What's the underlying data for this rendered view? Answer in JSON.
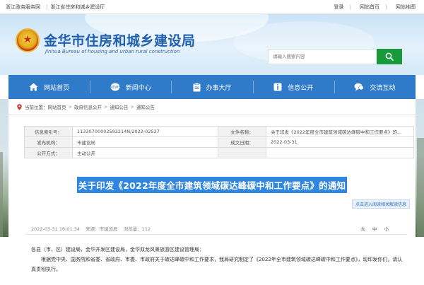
{
  "topbar": {
    "links_left": [
      "浙江政务服务网",
      "浙江省住房和城乡建设厅"
    ],
    "links_right": [
      "登录",
      "网站首页",
      "网站地图"
    ]
  },
  "header": {
    "title": "金华市住房和城乡建设局",
    "subtitle": "Jinhua Bureau of housing and urban rural construction",
    "search_placeholder": "请输入搜索内容"
  },
  "nav": [
    {
      "label": "网站首页",
      "icon": "home-icon"
    },
    {
      "label": "新闻中心",
      "icon": "news-icon"
    },
    {
      "label": "办事大厅",
      "icon": "clipboard-icon"
    },
    {
      "label": "信息公开",
      "icon": "info-icon"
    },
    {
      "label": "交流互动",
      "icon": "chat-icon"
    }
  ],
  "breadcrumb": [
    "当前位置：",
    "网站首页",
    "政府信息公开",
    "通知公告",
    "通知公告"
  ],
  "meta": {
    "index_label": "信息索引号：",
    "index_value": "11330700002592214N/2022-02527",
    "file_name_label": "文件名称：",
    "file_name_value": "关于印发《2022年度全市建筑领域碳达峰碳中和工作要点》的...",
    "issuer_label": "发布机构：",
    "issuer_value": "市建设局",
    "date_label": "成文日期：",
    "date_value": "2022-03-31",
    "mode_label": "公开方式：",
    "mode_value": "主动公开"
  },
  "doc": {
    "title": "关于印发《2022年度全市建筑领域碳达峰碳中和工作要点》的通知",
    "interpretation_button": "点击进入阅读相关解读信息",
    "publish_time": "2022-03-31 16:01:34",
    "source": "来源：市建设局",
    "views": "浏览量：112",
    "font_sizes": [
      "大",
      "中",
      "小"
    ],
    "salutation": "各县（市、区）建设局，金华开发区建设局，金华双龙风景旅游区建设管理局：",
    "paragraph": "根据党中央、国务院和省委、省政府、市委、市政府关于碳达峰碳中和工作要求，我局研究制定了《2022年全市建筑领域碳达峰碳中和工作要点》，现印发你们，请认真贯彻执行。"
  }
}
